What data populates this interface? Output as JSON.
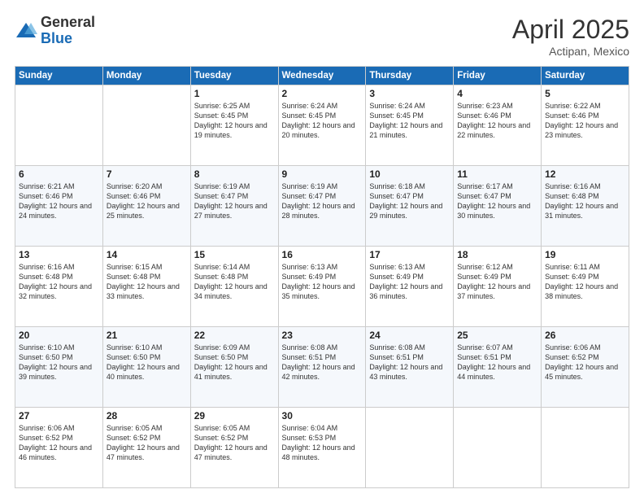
{
  "logo": {
    "general": "General",
    "blue": "Blue"
  },
  "title": {
    "month_year": "April 2025",
    "location": "Actipan, Mexico"
  },
  "weekdays": [
    "Sunday",
    "Monday",
    "Tuesday",
    "Wednesday",
    "Thursday",
    "Friday",
    "Saturday"
  ],
  "weeks": [
    [
      {
        "day": "",
        "info": ""
      },
      {
        "day": "",
        "info": ""
      },
      {
        "day": "1",
        "info": "Sunrise: 6:25 AM\nSunset: 6:45 PM\nDaylight: 12 hours and 19 minutes."
      },
      {
        "day": "2",
        "info": "Sunrise: 6:24 AM\nSunset: 6:45 PM\nDaylight: 12 hours and 20 minutes."
      },
      {
        "day": "3",
        "info": "Sunrise: 6:24 AM\nSunset: 6:45 PM\nDaylight: 12 hours and 21 minutes."
      },
      {
        "day": "4",
        "info": "Sunrise: 6:23 AM\nSunset: 6:46 PM\nDaylight: 12 hours and 22 minutes."
      },
      {
        "day": "5",
        "info": "Sunrise: 6:22 AM\nSunset: 6:46 PM\nDaylight: 12 hours and 23 minutes."
      }
    ],
    [
      {
        "day": "6",
        "info": "Sunrise: 6:21 AM\nSunset: 6:46 PM\nDaylight: 12 hours and 24 minutes."
      },
      {
        "day": "7",
        "info": "Sunrise: 6:20 AM\nSunset: 6:46 PM\nDaylight: 12 hours and 25 minutes."
      },
      {
        "day": "8",
        "info": "Sunrise: 6:19 AM\nSunset: 6:47 PM\nDaylight: 12 hours and 27 minutes."
      },
      {
        "day": "9",
        "info": "Sunrise: 6:19 AM\nSunset: 6:47 PM\nDaylight: 12 hours and 28 minutes."
      },
      {
        "day": "10",
        "info": "Sunrise: 6:18 AM\nSunset: 6:47 PM\nDaylight: 12 hours and 29 minutes."
      },
      {
        "day": "11",
        "info": "Sunrise: 6:17 AM\nSunset: 6:47 PM\nDaylight: 12 hours and 30 minutes."
      },
      {
        "day": "12",
        "info": "Sunrise: 6:16 AM\nSunset: 6:48 PM\nDaylight: 12 hours and 31 minutes."
      }
    ],
    [
      {
        "day": "13",
        "info": "Sunrise: 6:16 AM\nSunset: 6:48 PM\nDaylight: 12 hours and 32 minutes."
      },
      {
        "day": "14",
        "info": "Sunrise: 6:15 AM\nSunset: 6:48 PM\nDaylight: 12 hours and 33 minutes."
      },
      {
        "day": "15",
        "info": "Sunrise: 6:14 AM\nSunset: 6:48 PM\nDaylight: 12 hours and 34 minutes."
      },
      {
        "day": "16",
        "info": "Sunrise: 6:13 AM\nSunset: 6:49 PM\nDaylight: 12 hours and 35 minutes."
      },
      {
        "day": "17",
        "info": "Sunrise: 6:13 AM\nSunset: 6:49 PM\nDaylight: 12 hours and 36 minutes."
      },
      {
        "day": "18",
        "info": "Sunrise: 6:12 AM\nSunset: 6:49 PM\nDaylight: 12 hours and 37 minutes."
      },
      {
        "day": "19",
        "info": "Sunrise: 6:11 AM\nSunset: 6:49 PM\nDaylight: 12 hours and 38 minutes."
      }
    ],
    [
      {
        "day": "20",
        "info": "Sunrise: 6:10 AM\nSunset: 6:50 PM\nDaylight: 12 hours and 39 minutes."
      },
      {
        "day": "21",
        "info": "Sunrise: 6:10 AM\nSunset: 6:50 PM\nDaylight: 12 hours and 40 minutes."
      },
      {
        "day": "22",
        "info": "Sunrise: 6:09 AM\nSunset: 6:50 PM\nDaylight: 12 hours and 41 minutes."
      },
      {
        "day": "23",
        "info": "Sunrise: 6:08 AM\nSunset: 6:51 PM\nDaylight: 12 hours and 42 minutes."
      },
      {
        "day": "24",
        "info": "Sunrise: 6:08 AM\nSunset: 6:51 PM\nDaylight: 12 hours and 43 minutes."
      },
      {
        "day": "25",
        "info": "Sunrise: 6:07 AM\nSunset: 6:51 PM\nDaylight: 12 hours and 44 minutes."
      },
      {
        "day": "26",
        "info": "Sunrise: 6:06 AM\nSunset: 6:52 PM\nDaylight: 12 hours and 45 minutes."
      }
    ],
    [
      {
        "day": "27",
        "info": "Sunrise: 6:06 AM\nSunset: 6:52 PM\nDaylight: 12 hours and 46 minutes."
      },
      {
        "day": "28",
        "info": "Sunrise: 6:05 AM\nSunset: 6:52 PM\nDaylight: 12 hours and 47 minutes."
      },
      {
        "day": "29",
        "info": "Sunrise: 6:05 AM\nSunset: 6:52 PM\nDaylight: 12 hours and 47 minutes."
      },
      {
        "day": "30",
        "info": "Sunrise: 6:04 AM\nSunset: 6:53 PM\nDaylight: 12 hours and 48 minutes."
      },
      {
        "day": "",
        "info": ""
      },
      {
        "day": "",
        "info": ""
      },
      {
        "day": "",
        "info": ""
      }
    ]
  ]
}
